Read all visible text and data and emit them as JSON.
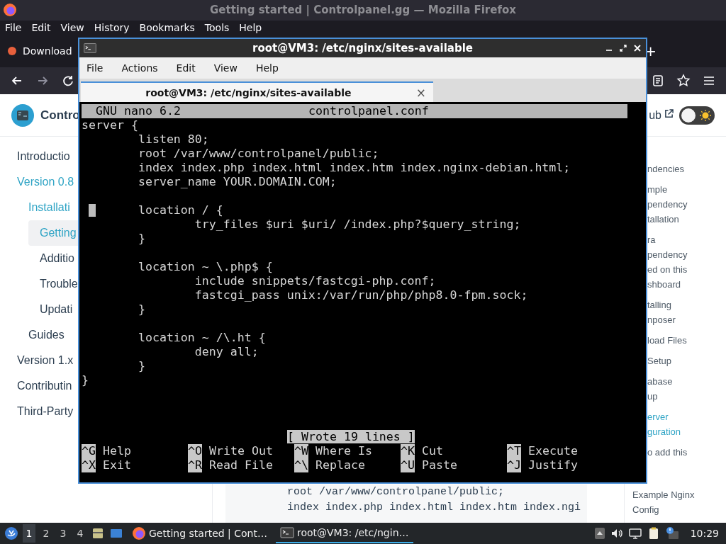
{
  "browser": {
    "title": "Getting started | Controlpanel.gg — Mozilla Firefox",
    "menu": [
      "File",
      "Edit",
      "View",
      "History",
      "Bookmarks",
      "Tools",
      "Help"
    ],
    "tabs": [
      {
        "label": "Download",
        "selected": false
      }
    ],
    "new_tab": "+"
  },
  "page": {
    "brand": "Contro",
    "header_link": "ub",
    "theme_toggle": {
      "on": false
    },
    "sidebar": [
      {
        "label": "Introductio",
        "active": false,
        "selected": false
      },
      {
        "label": "Version 0.8",
        "active": true,
        "selected": false,
        "children": [
          {
            "label": "Installati",
            "active": true,
            "selected": false,
            "children": [
              {
                "label": "Getting",
                "active": true,
                "selected": true
              },
              {
                "label": "Additio",
                "active": false,
                "selected": false
              },
              {
                "label": "Trouble",
                "active": false,
                "selected": false
              },
              {
                "label": "Updati",
                "active": false,
                "selected": false
              }
            ]
          },
          {
            "label": "Guides",
            "active": false,
            "selected": false
          }
        ]
      },
      {
        "label": "Version 1.x",
        "active": false,
        "selected": false
      },
      {
        "label": "Contributin",
        "active": false,
        "selected": false
      },
      {
        "label": "Third-Party",
        "active": false,
        "selected": false
      }
    ],
    "code_lines": [
      "root /var/www/controlpanel/public;",
      "index index.php index.html index.htm index.ngi"
    ],
    "toc": {
      "sub_items": [
        {
          "lines": [
            "ndencies"
          ],
          "selected": false
        },
        {
          "lines": [
            "mple",
            "pendency",
            "tallation"
          ],
          "selected": false
        },
        {
          "lines": [
            "ra",
            "pendency",
            "ed on this",
            "shboard"
          ],
          "selected": false
        },
        {
          "lines": [
            "talling",
            "nposer"
          ],
          "selected": false
        },
        {
          "lines": [
            "load Files"
          ],
          "selected": false
        },
        {
          "lines": [
            "Setup"
          ],
          "selected": false
        },
        {
          "lines": [
            "abase",
            "up"
          ],
          "selected": false
        },
        {
          "lines": [
            "erver",
            "guration"
          ],
          "selected": true
        },
        {
          "lines": [
            "o add this"
          ],
          "selected": false
        }
      ],
      "items": [
        {
          "lines": [
            "Example Nginx",
            "Config"
          ],
          "selected": false
        }
      ]
    }
  },
  "terminal": {
    "title": "root@VM3: /etc/nginx/sites-available",
    "menu": [
      "File",
      "Actions",
      "Edit",
      "View",
      "Help"
    ],
    "tabs": [
      {
        "label": "root@VM3: /etc/nginx/sites-available",
        "close": "×",
        "selected": true
      }
    ],
    "nano": {
      "version": "GNU nano 6.2",
      "file": "controlpanel.conf",
      "lines": [
        {
          "kind": "code",
          "text": "server {",
          "cursor": false
        },
        {
          "kind": "code",
          "text": "        listen 80;",
          "cursor": false
        },
        {
          "kind": "code",
          "text": "        root /var/www/controlpanel/public;",
          "cursor": false
        },
        {
          "kind": "code",
          "text": "        index index.php index.html index.htm index.nginx-debian.html;",
          "cursor": false
        },
        {
          "kind": "code",
          "text": "        server_name YOUR.DOMAIN.COM;",
          "cursor": false
        },
        {
          "kind": "blank"
        },
        {
          "kind": "code",
          "text": "        location / {",
          "cursor": true
        },
        {
          "kind": "code",
          "text": "                try_files $uri $uri/ /index.php?$query_string;",
          "cursor": false
        },
        {
          "kind": "code",
          "text": "        }",
          "cursor": false
        },
        {
          "kind": "blank"
        },
        {
          "kind": "code",
          "text": "        location ~ \\.php$ {",
          "cursor": false
        },
        {
          "kind": "code",
          "text": "                include snippets/fastcgi-php.conf;",
          "cursor": false
        },
        {
          "kind": "code",
          "text": "                fastcgi_pass unix:/var/run/php/php8.0-fpm.sock;",
          "cursor": false
        },
        {
          "kind": "code",
          "text": "        }",
          "cursor": false
        },
        {
          "kind": "blank"
        },
        {
          "kind": "code",
          "text": "        location ~ /\\.ht {",
          "cursor": false
        },
        {
          "kind": "code",
          "text": "                deny all;",
          "cursor": false
        },
        {
          "kind": "code",
          "text": "        }",
          "cursor": false
        },
        {
          "kind": "code",
          "text": "}",
          "cursor": false
        }
      ],
      "status": "[ Wrote 19 lines ]",
      "shortcuts": [
        [
          {
            "key": "^G",
            "label": "Help"
          },
          {
            "key": "^O",
            "label": "Write Out"
          },
          {
            "key": "^W",
            "label": "Where Is"
          },
          {
            "key": "^K",
            "label": "Cut"
          },
          {
            "key": "^T",
            "label": "Execute"
          }
        ],
        [
          {
            "key": "^X",
            "label": "Exit"
          },
          {
            "key": "^R",
            "label": "Read File"
          },
          {
            "key": "^\\",
            "label": "Replace"
          },
          {
            "key": "^U",
            "label": "Paste"
          },
          {
            "key": "^J",
            "label": "Justify"
          }
        ]
      ]
    }
  },
  "taskbar": {
    "workspaces": [
      {
        "label": "1",
        "selected": true
      },
      {
        "label": "2",
        "selected": false
      },
      {
        "label": "3",
        "selected": false
      },
      {
        "label": "4",
        "selected": false
      }
    ],
    "tasks": [
      {
        "kind": "browser",
        "label": "Getting started | Cont…",
        "selected": false
      },
      {
        "kind": "terminal",
        "label": "root@VM3: /etc/ngin…",
        "selected": true
      }
    ],
    "clock": "10:29"
  }
}
